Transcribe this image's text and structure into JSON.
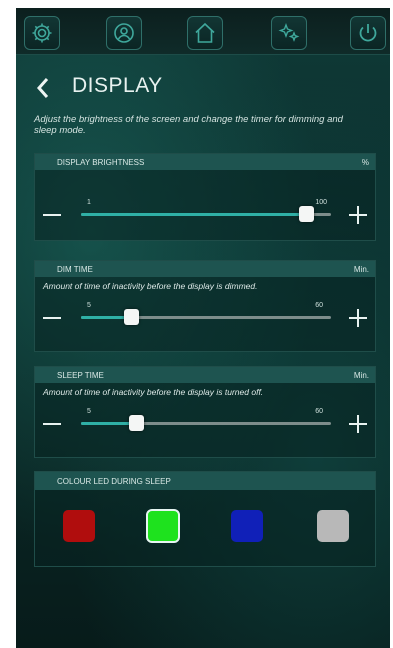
{
  "topbar": {
    "icons": [
      "gear-icon",
      "user-icon",
      "home-icon",
      "sparkle-icon",
      "power-icon"
    ]
  },
  "header": {
    "title": "DISPLAY",
    "description": "Adjust the brightness of the screen and change the timer for dimming and sleep mode."
  },
  "brightness": {
    "label": "DISPLAY BRIGHTNESS",
    "unit": "%",
    "min_label": "1",
    "max_label": "100",
    "value_fraction": 0.9
  },
  "dim_time": {
    "label": "DIM TIME",
    "unit": "Min.",
    "description": "Amount of time of inactivity before the display is dimmed.",
    "min_label": "5",
    "max_label": "60",
    "value_fraction": 0.2
  },
  "sleep_time": {
    "label": "SLEEP TIME",
    "unit": "Min.",
    "description": "Amount of time of inactivity before the display is turned off.",
    "min_label": "5",
    "max_label": "60",
    "value_fraction": 0.22
  },
  "led": {
    "label": "COLOUR LED DURING SLEEP",
    "colors": [
      {
        "name": "red",
        "hex": "#b00d0d"
      },
      {
        "name": "green",
        "hex": "#1ee21e"
      },
      {
        "name": "blue",
        "hex": "#1020b8"
      },
      {
        "name": "grey",
        "hex": "#b8b8b8"
      }
    ],
    "selected": "green"
  }
}
